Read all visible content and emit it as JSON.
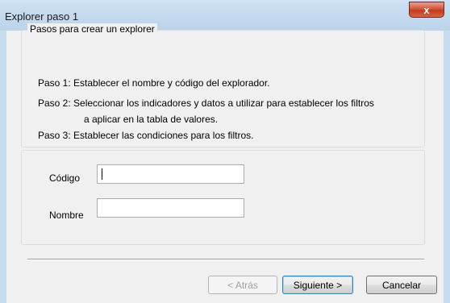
{
  "window": {
    "title": "Explorer paso 1",
    "close_label": "x"
  },
  "steps_group": {
    "legend": "Pasos para crear un explorer",
    "lines": [
      "Paso 1: Establecer el nombre y código del explorador.",
      "Paso 2: Seleccionar los indicadores y datos a utilizar para establecer los filtros",
      "a aplicar en la tabla de valores.",
      "Paso 3: Establecer las condiciones para los filtros."
    ]
  },
  "form": {
    "codigo_label": "Código",
    "codigo_value": "",
    "nombre_label": "Nombre",
    "nombre_value": ""
  },
  "buttons": {
    "back": "< Atrás",
    "next": "Siguiente >",
    "cancel": "Cancelar"
  },
  "colors": {
    "titlebar": "#c7dcef",
    "client": "#f0f0f0",
    "close": "#c23a1f",
    "default_button_border": "#3c7fb1"
  }
}
